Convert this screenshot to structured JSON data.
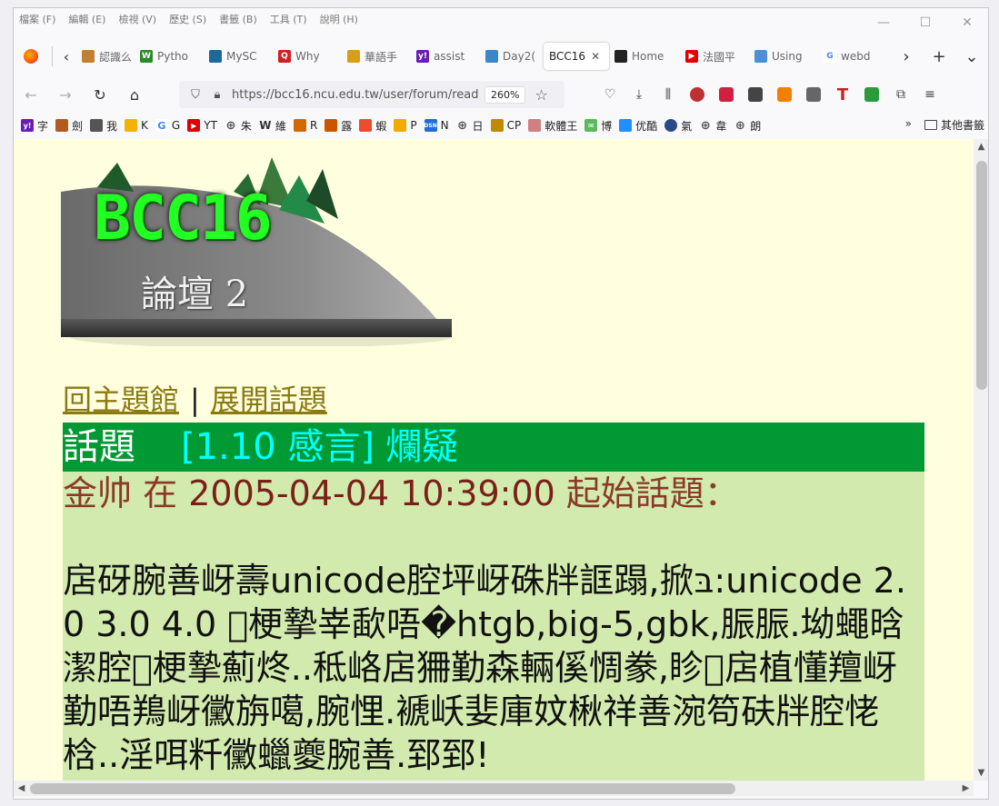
{
  "menu": [
    "檔案 (F)",
    "編輯 (E)",
    "檢視 (V)",
    "歷史 (S)",
    "書籤 (B)",
    "工具 (T)",
    "說明 (H)"
  ],
  "window_controls": {
    "minimize": "—",
    "maximize": "☐",
    "close": "✕"
  },
  "tabs": [
    {
      "label": "認識么",
      "icon_color": "#c08030"
    },
    {
      "label": "Pytho",
      "icon_color": "#2a8a2a"
    },
    {
      "label": "MySC",
      "icon_color": "#1b6a9a"
    },
    {
      "label": "Why",
      "icon_color": "#cc2222"
    },
    {
      "label": "華語手",
      "icon_color": "#d4a017"
    },
    {
      "label": "assist",
      "icon_color": "#6a1bb8"
    },
    {
      "label": "Day2(",
      "icon_color": "#3a88c8"
    },
    {
      "label": "BCC16",
      "icon_color": "",
      "active": true
    },
    {
      "label": "Home",
      "icon_color": "#222222"
    },
    {
      "label": "法國平",
      "icon_color": "#e00000"
    },
    {
      "label": "Using",
      "icon_color": "#4a90d9"
    },
    {
      "label": "webd",
      "icon_color": "#4285f4"
    }
  ],
  "url": {
    "text": "https://bcc16.ncu.edu.tw/user/forum/read",
    "zoom": "260%"
  },
  "bookmarks": [
    {
      "label": "字",
      "color": "#6a1bb8",
      "icon": "y!"
    },
    {
      "label": "劍",
      "color": "#b35a1f",
      "icon": ""
    },
    {
      "label": "我",
      "color": "#555555",
      "icon": ""
    },
    {
      "label": "K",
      "color": "#f2b400",
      "icon": ""
    },
    {
      "label": "G",
      "color": "#4285f4",
      "icon": "G"
    },
    {
      "label": "YT",
      "color": "#e00000",
      "icon": "▶"
    },
    {
      "label": "朱",
      "color": "#666666",
      "icon": "⊕"
    },
    {
      "label": "維",
      "color": "#333333",
      "icon": "W"
    },
    {
      "label": "R",
      "color": "#d06a00",
      "icon": ""
    },
    {
      "label": "露",
      "color": "#cc5500",
      "icon": ""
    },
    {
      "label": "蝦",
      "color": "#ee4d2d",
      "icon": ""
    },
    {
      "label": "P",
      "color": "#f2a900",
      "icon": ""
    },
    {
      "label": "N",
      "color": "#1e6fd9",
      "icon": "DSN"
    },
    {
      "label": "日",
      "color": "#666666",
      "icon": "⊕"
    },
    {
      "label": "CP",
      "color": "#c08a00",
      "icon": ""
    },
    {
      "label": "軟體王",
      "color": "#d08080",
      "icon": ""
    },
    {
      "label": "博",
      "color": "#5cb85c",
      "icon": "✉"
    },
    {
      "label": "优酷",
      "color": "#1e90ff",
      "icon": ""
    },
    {
      "label": "氣",
      "color": "#2a4a8a",
      "icon": ""
    },
    {
      "label": "韋",
      "color": "#666666",
      "icon": "⊕"
    },
    {
      "label": "朗",
      "color": "#666666",
      "icon": "⊕"
    }
  ],
  "bookmarks_more": "»",
  "bookmarks_other": "其他書籤",
  "banner": {
    "title": "BCC16",
    "subtitle": "論壇 2"
  },
  "nav": {
    "back_to_main": "回主題館",
    "separator": "|",
    "expand_topics": "展開話題"
  },
  "topic": {
    "label": "話題",
    "subject_tag": "[1.10 感言]",
    "subject": "爛疑"
  },
  "post": {
    "author": "金帅",
    "verb": "在",
    "datetime": "2005-04-04 10:39:00",
    "action": "起始話題：",
    "body": "扂砑腕善岈壽unicode腔坪岈硃牉誆蹋,掀בּ:unicode 2.0 3.0 4.0 梗摯峷歃唔�htgb,big-5,gbk,脤脤.坳蠅晗潔腔梗摯薊炵..秪峈扂狦勤森輛傒惆豢,眕扂植懂羶岈勤唔鴹岈黴旃噶,腕悝.褫岆婓庫妏楸祥善涴笱砆牉腔恅梒..淫咡粁黴蠟夔腕善.郅郅!"
  }
}
